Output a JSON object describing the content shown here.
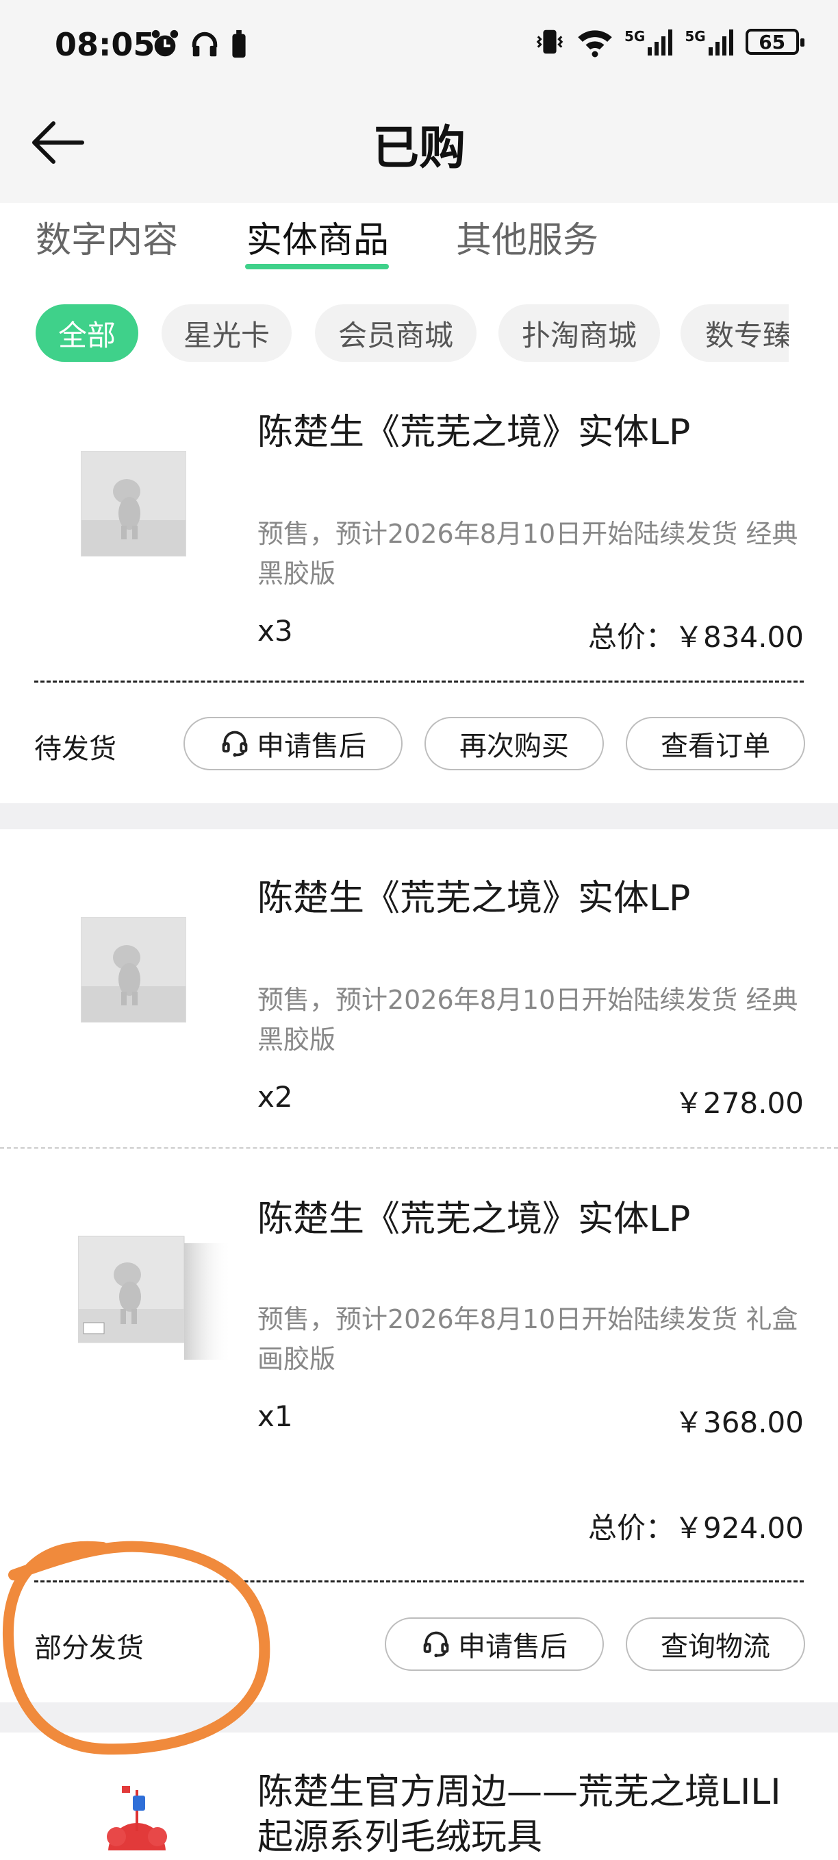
{
  "status_bar": {
    "time": "08:05",
    "left_icons": [
      "alarm-icon",
      "headphones-icon",
      "battery-saver-icon"
    ],
    "right_icons": [
      "vibrate-icon",
      "wifi-icon",
      "5g-signal-icon",
      "5g-signal-icon"
    ],
    "network_1": "5G",
    "network_2": "5G",
    "battery": "65"
  },
  "header": {
    "title": "已购",
    "back_icon": "back-arrow-icon"
  },
  "tabs": [
    {
      "label": "数字内容",
      "active": false
    },
    {
      "label": "实体商品",
      "active": true
    },
    {
      "label": "其他服务",
      "active": false
    }
  ],
  "accent_color": "#3fd18a",
  "filters": [
    {
      "label": "全部",
      "active": true
    },
    {
      "label": "星光卡"
    },
    {
      "label": "会员商城"
    },
    {
      "label": "扑淘商城"
    },
    {
      "label": "数专臻"
    }
  ],
  "orders": [
    {
      "items": [
        {
          "title": "陈楚生《荒芜之境》实体LP",
          "desc": "预售，预计2026年8月10日开始陆续发货 经典黑胶版",
          "qty": "x3",
          "price": "总价：￥834.00"
        }
      ],
      "status": "待发货",
      "actions": [
        "申请售后",
        "再次购买",
        "查看订单"
      ]
    },
    {
      "items": [
        {
          "title": "陈楚生《荒芜之境》实体LP",
          "desc": "预售，预计2026年8月10日开始陆续发货 经典黑胶版",
          "qty": "x2",
          "price": "￥278.00"
        },
        {
          "title": "陈楚生《荒芜之境》实体LP",
          "desc": "预售，预计2026年8月10日开始陆续发货 礼盒画胶版",
          "qty": "x1",
          "price": "￥368.00"
        }
      ],
      "total": "总价：￥924.00",
      "status": "部分发货",
      "actions": [
        "申请售后",
        "查询物流"
      ]
    },
    {
      "items": [
        {
          "title": "陈楚生官方周边——荒芜之境LILI起源系列毛绒玩具"
        }
      ]
    }
  ],
  "annotation_color": "#f08a3c"
}
